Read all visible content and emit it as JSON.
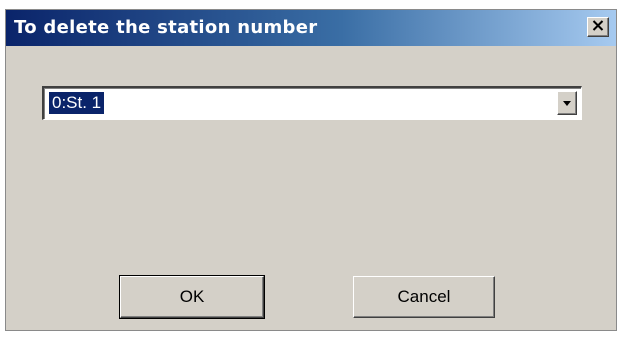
{
  "dialog": {
    "title": "To delete the station number",
    "close_icon": "close-icon"
  },
  "station_select": {
    "selected_value": "0:St. 1",
    "dropdown_icon": "chevron-down-icon"
  },
  "buttons": {
    "ok_label": "OK",
    "cancel_label": "Cancel"
  },
  "colors": {
    "titlebar_start": "#0a246a",
    "titlebar_end": "#a6caf0",
    "dialog_face": "#d4d0c8",
    "selection": "#0a246a"
  }
}
